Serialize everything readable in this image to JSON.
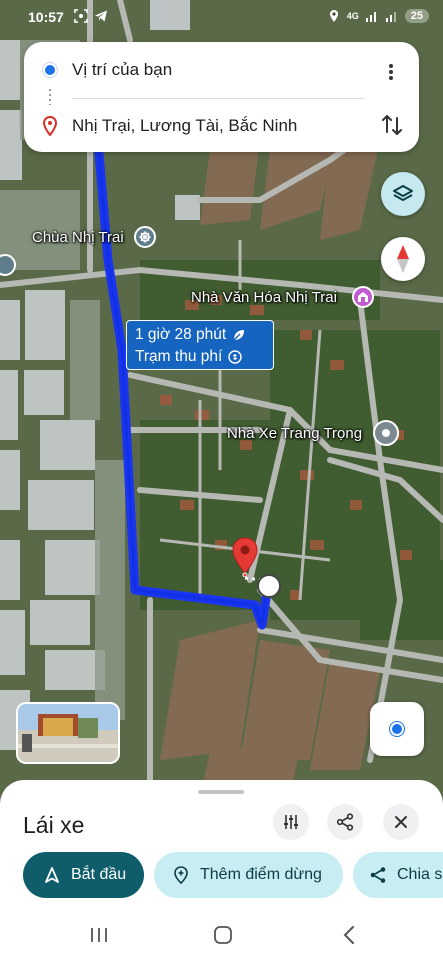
{
  "status_bar": {
    "time": "10:57",
    "network": "4G",
    "battery": "25"
  },
  "route_card": {
    "origin": "Vị trí của bạn",
    "destination": "Nhị Trại, Lương Tài, Bắc Ninh"
  },
  "map": {
    "labels": {
      "pagoda": "Chùa Nhị Trai",
      "cultural_house": "Nhà Văn Hóa Nhị Trai",
      "bus_company": "Nhà Xe Trang Trọng"
    },
    "route_bubble": {
      "duration": "1 giờ 28 phút",
      "toll": "Trạm thu phí"
    },
    "colors": {
      "route": "#1a3cf5",
      "destination_pin": "#e53935"
    }
  },
  "sheet": {
    "title": "Lái xe",
    "buttons": {
      "start": "Bắt đầu",
      "add_stop": "Thêm điểm dừng",
      "share": "Chia s"
    }
  }
}
